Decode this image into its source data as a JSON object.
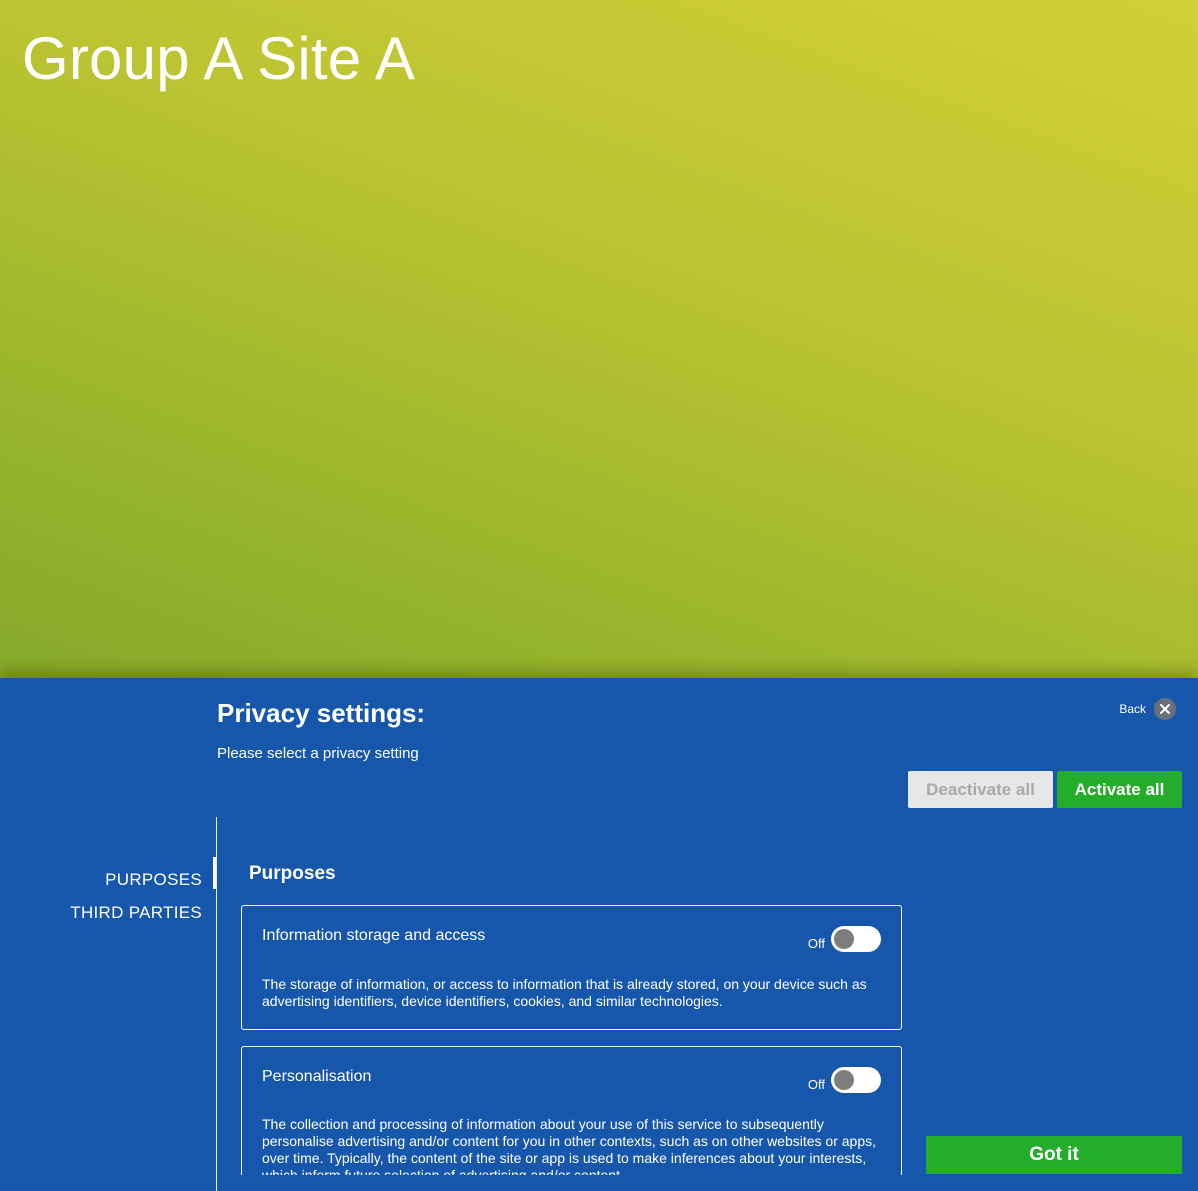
{
  "hero": {
    "title": "Group A Site A"
  },
  "privacy": {
    "title": "Privacy settings:",
    "subtitle": "Please select a privacy setting",
    "back_label": "Back",
    "deactivate_all_label": "Deactivate all",
    "activate_all_label": "Activate all",
    "got_it_label": "Got it",
    "nav": [
      {
        "label": "PURPOSES",
        "active": true
      },
      {
        "label": "THIRD PARTIES",
        "active": false
      }
    ],
    "section_title": "Purposes",
    "cards": [
      {
        "title": "Information storage and access",
        "toggle_label": "Off",
        "toggle_on": false,
        "description": "The storage of information, or access to information that is already stored, on your device such as advertising identifiers, device identifiers, cookies, and similar technologies."
      },
      {
        "title": "Personalisation",
        "toggle_label": "Off",
        "toggle_on": false,
        "description": "The collection and processing of information about your use of this service to subsequently personalise advertising and/or content for you in other contexts, such as on other websites or apps, over time. Typically, the content of the site or app is used to make inferences about your interests, which inform future selection of advertising and/or content."
      }
    ]
  },
  "colors": {
    "panel_blue": "#1657ab",
    "green": "#24ac2b",
    "hero_gradient_light": "#d2cf36",
    "hero_gradient_dark": "#86a929"
  },
  "icons": {
    "back": "close-icon"
  }
}
